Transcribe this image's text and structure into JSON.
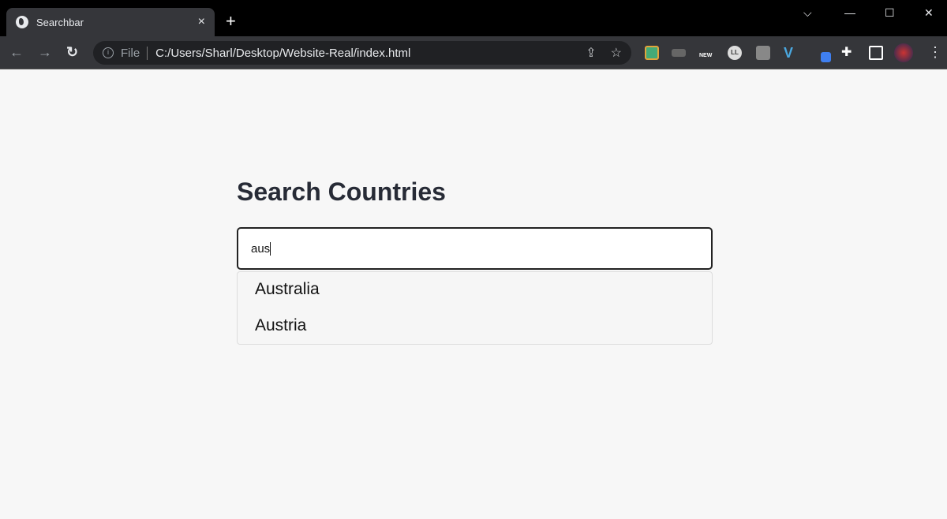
{
  "browser": {
    "tab_title": "Searchbar",
    "close_tab": "×",
    "new_tab": "+",
    "window_controls": {
      "tabsearch": "⌵",
      "minimize": "—",
      "maximize": "☐",
      "close": "✕"
    },
    "nav": {
      "back": "←",
      "forward": "→",
      "reload": "↻"
    },
    "omnibox": {
      "info": "i",
      "scheme_label": "File",
      "url": "C:/Users/Sharl/Desktop/Website-Real/index.html",
      "share": "⇪",
      "bookmark": "☆"
    },
    "menu": "⋮",
    "extension_icons": [
      "photo-ext-icon",
      "cast-ext-icon",
      "new-ext-icon",
      "ll-ext-icon",
      "grey-ext-icon",
      "vimeo-ext-icon",
      "eyedropper-ext-icon",
      "puzzle-extensions-icon",
      "reading-mode-icon",
      "profile-avatar"
    ],
    "new_badge": "NEW",
    "ll_label": "LL",
    "vimeo_label": "V"
  },
  "page": {
    "heading": "Search Countries",
    "search_value": "aus",
    "results": [
      "Australia",
      "Austria"
    ]
  }
}
